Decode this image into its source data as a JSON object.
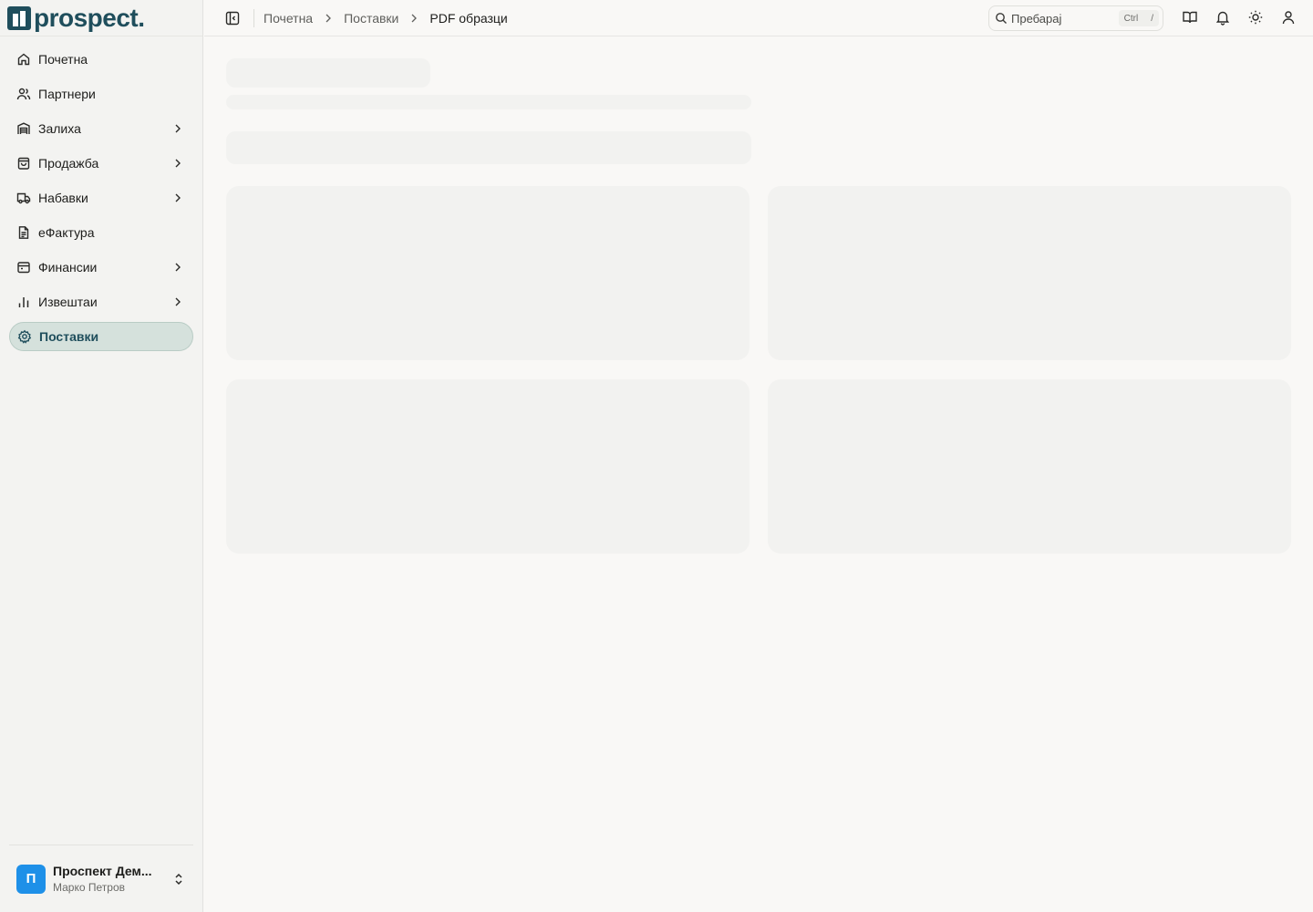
{
  "brand": {
    "name": "prospect."
  },
  "sidebar": {
    "items": [
      {
        "label": "Почетна",
        "icon": "home-icon",
        "has_children": false,
        "active": false
      },
      {
        "label": "Партнери",
        "icon": "users-icon",
        "has_children": false,
        "active": false
      },
      {
        "label": "Залиха",
        "icon": "warehouse-icon",
        "has_children": true,
        "active": false
      },
      {
        "label": "Продажба",
        "icon": "shopping-bag-icon",
        "has_children": true,
        "active": false
      },
      {
        "label": "Набавки",
        "icon": "truck-icon",
        "has_children": true,
        "active": false
      },
      {
        "label": "еФактура",
        "icon": "document-icon",
        "has_children": false,
        "active": false
      },
      {
        "label": "Финансии",
        "icon": "wallet-icon",
        "has_children": true,
        "active": false
      },
      {
        "label": "Извештаи",
        "icon": "bar-chart-icon",
        "has_children": true,
        "active": false
      },
      {
        "label": "Поставки",
        "icon": "gear-icon",
        "has_children": false,
        "active": true
      }
    ],
    "footer": {
      "avatar_letter": "П",
      "org_name": "Проспект Дем...",
      "user_name": "Марко Петров"
    }
  },
  "header": {
    "breadcrumbs": [
      "Почетна",
      "Поставки",
      "PDF образци"
    ],
    "search": {
      "placeholder": "Пребарај",
      "shortcut_key": "Ctrl",
      "shortcut_char": "/"
    },
    "icons": [
      "book-icon",
      "bell-icon",
      "sun-icon",
      "user-icon"
    ]
  },
  "colors": {
    "brand": "#1f4e5c",
    "active_bg": "#d5e1dc",
    "avatar_bg": "#1e90e8",
    "skeleton": "#f2f2f0"
  },
  "main": {
    "state": "loading"
  }
}
